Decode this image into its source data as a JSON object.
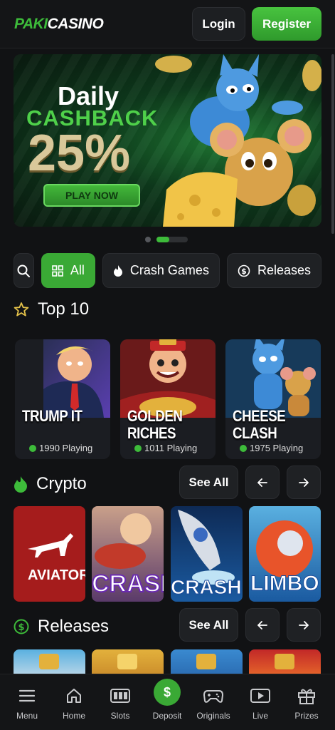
{
  "header": {
    "logo_part1": "PAKI",
    "logo_part2": "CASINO",
    "login_label": "Login",
    "register_label": "Register"
  },
  "banner": {
    "line1": "Daily",
    "line2": "CASHBACK",
    "line3": "25%",
    "cta": "PLAY NOW"
  },
  "filters": {
    "items": [
      {
        "label": "All",
        "icon": "grid-icon",
        "active": true
      },
      {
        "label": "Crash Games",
        "icon": "flame-icon"
      },
      {
        "label": "Releases",
        "icon": "dollar-circle-icon"
      }
    ]
  },
  "top10": {
    "title": "Top 10",
    "cards": [
      {
        "title_l1": "TRUMP IT",
        "title_l2": "",
        "playing": "1990 Playing"
      },
      {
        "title_l1": "GOLDEN",
        "title_l2": "RICHES",
        "playing": "1011 Playing"
      },
      {
        "title_l1": "CHEESE",
        "title_l2": "CLASH",
        "playing": "1975 Playing"
      }
    ]
  },
  "crypto": {
    "title": "Crypto",
    "see_all": "See All",
    "tiles": [
      "AVIATOR",
      "CRASH",
      "CRASH",
      "LIMBO"
    ]
  },
  "releases": {
    "title": "Releases",
    "see_all": "See All"
  },
  "bottom_nav": {
    "items": [
      {
        "label": "Menu",
        "icon": "hamburger-icon"
      },
      {
        "label": "Home",
        "icon": "home-icon"
      },
      {
        "label": "Slots",
        "icon": "slots-icon"
      },
      {
        "label": "Deposit",
        "icon": "dollar-icon",
        "symbol": "$"
      },
      {
        "label": "Originals",
        "icon": "gamepad-icon"
      },
      {
        "label": "Live",
        "icon": "play-icon"
      },
      {
        "label": "Prizes",
        "icon": "gift-icon"
      }
    ]
  },
  "colors": {
    "accent": "#3aa935",
    "background": "#111214",
    "surface": "#1f2124"
  }
}
